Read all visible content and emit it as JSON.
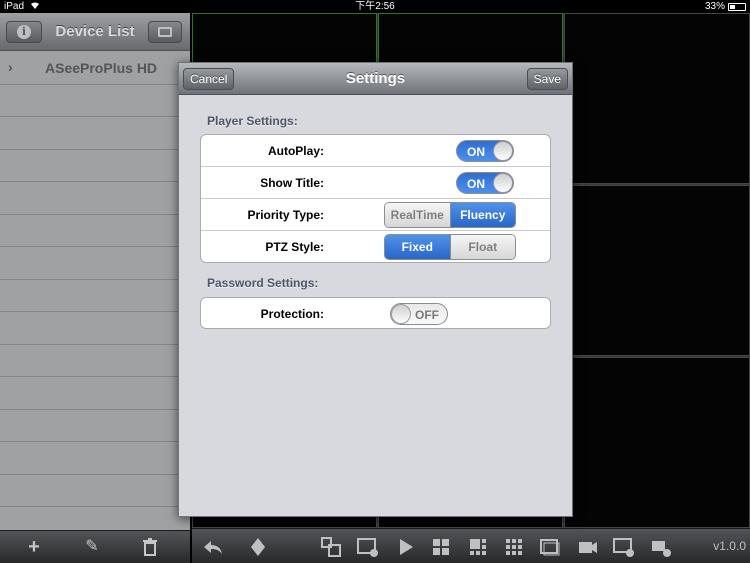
{
  "status_bar": {
    "device": "iPad",
    "time": "下午2:56",
    "battery": "33%"
  },
  "sidebar": {
    "title": "Device List",
    "devices": [
      {
        "name": "ASeeProPlus HD"
      }
    ]
  },
  "main_toolbar": {
    "version": "v1.0.0"
  },
  "settings_modal": {
    "title": "Settings",
    "cancel_label": "Cancel",
    "save_label": "Save",
    "player_section": {
      "label": "Player Settings:",
      "autoplay": {
        "label": "AutoPlay:",
        "state": "ON"
      },
      "show_title": {
        "label": "Show Title:",
        "state": "ON"
      },
      "priority_type": {
        "label": "Priority Type:",
        "options": [
          "RealTime",
          "Fluency"
        ],
        "selected": "Fluency"
      },
      "ptz_style": {
        "label": "PTZ Style:",
        "options": [
          "Fixed",
          "Float"
        ],
        "selected": "Fixed"
      }
    },
    "password_section": {
      "label": "Password Settings:",
      "protection": {
        "label": "Protection:",
        "state": "OFF"
      }
    }
  },
  "colors": {
    "accent_blue": "#2f6dd1",
    "selected_cell_border": "#2f7a2f"
  }
}
